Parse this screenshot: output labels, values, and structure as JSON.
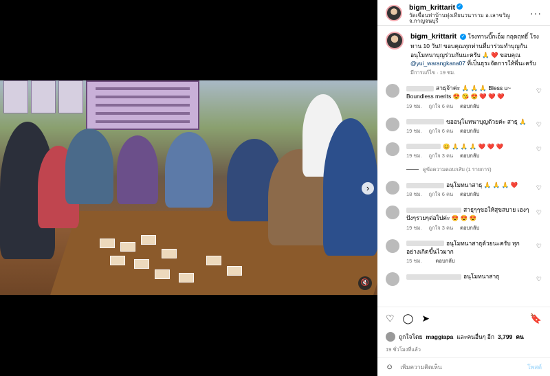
{
  "post": {
    "username": "bigm_krittarit",
    "location": "วัดเขื่อนท่าบ้านทุ่งเทียนวนาราม อ.เลาขวัญ จ.กาญจนบุรี",
    "caption": "โรงทานบิ๊กเอ็ม กฤตฤทธิ์ โรงทาน 10 วัน!! ขอบคุณทุกท่านที่มาร่วมทำบุญกัน อนุโมทนาบุญร่วมกันนะครับ 🙏 ❤️ ขอบคุณ",
    "caption_mention": "@yui_warangkana07",
    "caption_end": "ที่เป็นธุระจัดการให้พี่นะครับ",
    "caption_meta": "มีการแก้ไข · 19 ชม."
  },
  "comments": [
    {
      "text": "สาธุจ้าค่ะ 🙏 🙏 🙏 Bless u~ Boundless merits 😍 😘 😍 ❤️ ❤️ ❤️",
      "time": "19 ชม.",
      "likes": "ถูกใจ 6 คน",
      "reply": "ตอบกลับ"
    },
    {
      "text": "ขออนุโมทนาบุญด้วยค่ะ สาธุ 🙏",
      "time": "19 ชม.",
      "likes": "ถูกใจ 6 คน",
      "reply": "ตอบกลับ"
    },
    {
      "text": "😊 🙏 🙏 🙏 ❤️ ❤️ ❤️",
      "time": "19 ชม.",
      "likes": "ถูกใจ 3 คน",
      "reply": "ตอบกลับ"
    },
    {
      "text": "อนุโมทนาสาธุ 🙏 🙏 🙏 ❤️",
      "time": "18 ชม.",
      "likes": "ถูกใจ 6 คน",
      "reply": "ตอบกลับ"
    },
    {
      "text": "สาธุๆๆขอให้สุขสบาย เฮงๆ ปังๆรวยๆต่อไปค่ะ 😍 😍 😍",
      "time": "19 ชม.",
      "likes": "ถูกใจ 3 คน",
      "reply": "ตอบกลับ"
    },
    {
      "text": "อนุโมทนาสาธุด้วยนะครับ ทุกอย่างเกิดขึ้นไวมาก",
      "time": "15 ชม.",
      "likes": "",
      "reply": "ตอบกลับ"
    },
    {
      "text": "อนุโมทนาสาธุ",
      "time": "",
      "likes": "",
      "reply": ""
    }
  ],
  "view_replies": "ดูข้อความตอบกลับ (1 รายการ)",
  "likes_line": {
    "prefix": "ถูกใจโดย",
    "user": "maggiapa",
    "mid": "และคนอื่นๆ อีก",
    "count": "3,799",
    "suffix": "คน"
  },
  "timestamp": "19 ชั่วโมงที่แล้ว",
  "add_comment": {
    "placeholder": "เพิ่มความคิดเห็น",
    "post_label": "โพสต์"
  },
  "icons": {
    "like": "heart-icon",
    "comment": "comment-icon",
    "share": "share-icon",
    "save": "bookmark-icon",
    "more": "more-icon",
    "mute": "mute-icon",
    "next": "chevron-right-icon",
    "emoji": "emoji-icon"
  },
  "colors": {
    "accent": "#0095f6",
    "link": "#00376b",
    "muted": "#737373",
    "post_disabled": "#b2dffc"
  }
}
